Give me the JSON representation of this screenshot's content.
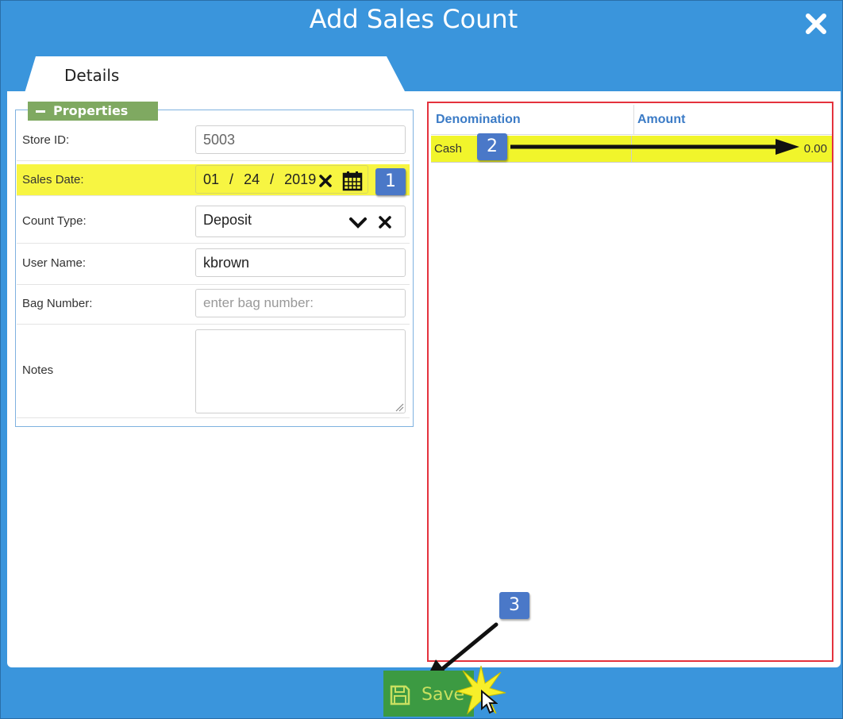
{
  "dialog": {
    "title": "Add Sales Count"
  },
  "tabs": [
    {
      "label": "Details"
    }
  ],
  "properties": {
    "legend": "Properties",
    "store_id": {
      "label": "Store ID:",
      "value": "5003"
    },
    "sales_date": {
      "label": "Sales Date:",
      "month": "01",
      "day": "24",
      "year": "2019",
      "separator": "/"
    },
    "count_type": {
      "label": "Count Type:",
      "value": "Deposit"
    },
    "user_name": {
      "label": "User Name:",
      "value": "kbrown"
    },
    "bag_number": {
      "label": "Bag Number:",
      "placeholder": "enter bag number:"
    },
    "notes": {
      "label": "Notes",
      "value": ""
    }
  },
  "grid": {
    "columns": [
      "Denomination",
      "Amount"
    ],
    "rows": [
      {
        "denomination": "Cash",
        "amount": "0.00"
      }
    ]
  },
  "footer": {
    "save_label": "Save"
  },
  "annotations": {
    "badge_1": "1",
    "badge_2": "2",
    "badge_3": "3"
  },
  "icons": {
    "close": "close-icon",
    "calendar": "calendar-icon",
    "clear": "clear-icon",
    "dropdown": "chevron-down-icon",
    "save": "floppy-disk-icon"
  },
  "colors": {
    "header": "#3a95dc",
    "legend": "#7fa961",
    "highlight": "#f7f542",
    "badge": "#4a78c8",
    "grid_border": "#e4323d",
    "save_button": "#3c9a42"
  }
}
